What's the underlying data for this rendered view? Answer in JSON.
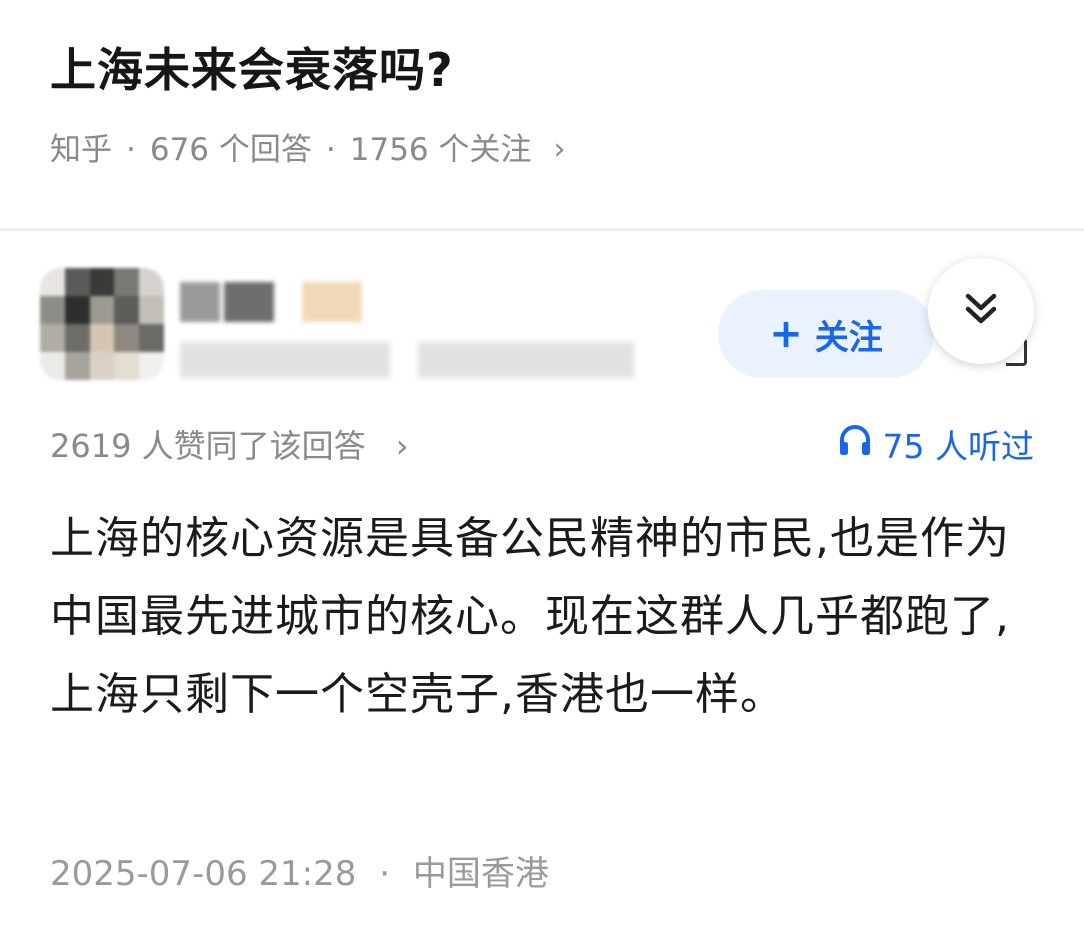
{
  "question": {
    "title": "上海未来会衰落吗?",
    "source": "知乎",
    "separator": "·",
    "answers": "676 个回答",
    "follows": "1756 个关注",
    "chevron": "›"
  },
  "author": {
    "follow_label": "关注",
    "follow_icon": "plus-icon",
    "collapse_icon": "double-chevron-down-icon"
  },
  "stats": {
    "agree": "2619 人赞同了该回答",
    "agree_chevron": "›",
    "listen_icon": "headphones-icon",
    "listen": "75 人听过"
  },
  "answer": {
    "text": "上海的核心资源是具备公民精神的市民,也是作为中国最先进城市的核心。现在这群人几乎都跑了,上海只剩下一个空壳子,香港也一样。"
  },
  "footer": {
    "datetime": "2025-07-06 21:28",
    "separator": "·",
    "location": "中国香港"
  },
  "colors": {
    "accent": "#1a66e8",
    "follow_bg": "#eaf2fe",
    "meta_gray": "#8a8a8a"
  }
}
